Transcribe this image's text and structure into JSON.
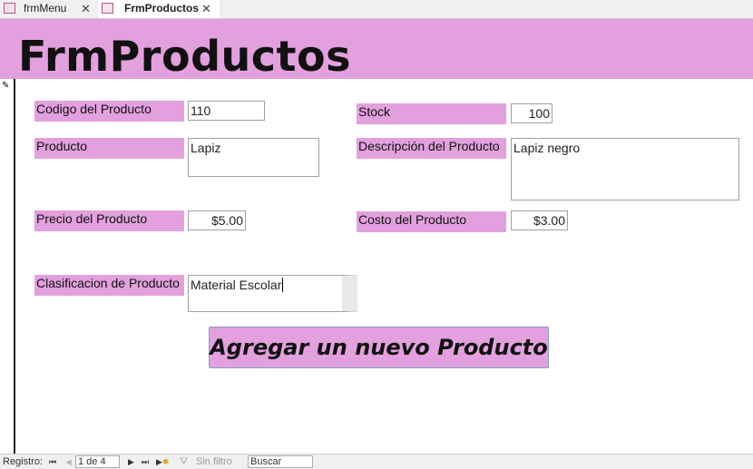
{
  "tabs": [
    {
      "label": "frmMenu"
    },
    {
      "label": "FrmProductos"
    }
  ],
  "form": {
    "title": "FrmProductos"
  },
  "fields": {
    "codigo": {
      "label": "Codigo del Producto",
      "value": "110"
    },
    "producto": {
      "label": "Producto",
      "value": "Lapiz"
    },
    "precio": {
      "label": "Precio del Producto",
      "value": "$5.00"
    },
    "clasificacion": {
      "label": "Clasificacion de Producto",
      "value": "Material Escolar"
    },
    "stock": {
      "label": "Stock",
      "value": "100"
    },
    "descripcion": {
      "label": "Descripción del Producto",
      "value": "Lapiz negro"
    },
    "costo": {
      "label": "Costo del Producto",
      "value": "$3.00"
    }
  },
  "add_button": "Agregar un nuevo Producto",
  "nav": {
    "label": "Registro:",
    "record": "1 de 4",
    "filter": "Sin filtro",
    "search": "Buscar"
  }
}
